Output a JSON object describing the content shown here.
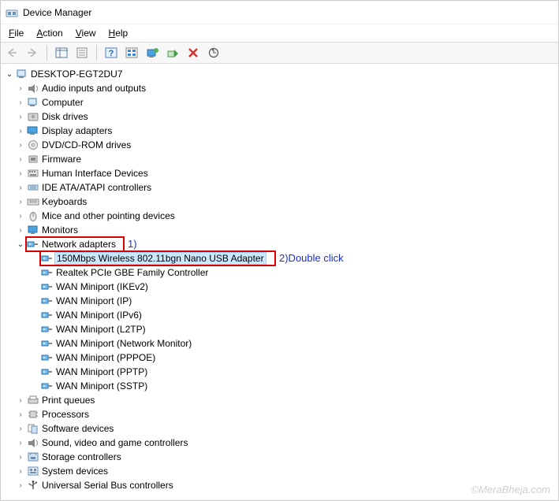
{
  "window": {
    "title": "Device Manager"
  },
  "menu": {
    "file": "File",
    "action": "Action",
    "view": "View",
    "help": "Help"
  },
  "root": {
    "name": "DESKTOP-EGT2DU7"
  },
  "categories": [
    {
      "label": "Audio inputs and outputs",
      "icon": "audio"
    },
    {
      "label": "Computer",
      "icon": "computer"
    },
    {
      "label": "Disk drives",
      "icon": "disk"
    },
    {
      "label": "Display adapters",
      "icon": "display"
    },
    {
      "label": "DVD/CD-ROM drives",
      "icon": "dvd"
    },
    {
      "label": "Firmware",
      "icon": "firmware"
    },
    {
      "label": "Human Interface Devices",
      "icon": "hid"
    },
    {
      "label": "IDE ATA/ATAPI controllers",
      "icon": "ide"
    },
    {
      "label": "Keyboards",
      "icon": "keyboard"
    },
    {
      "label": "Mice and other pointing devices",
      "icon": "mouse"
    },
    {
      "label": "Monitors",
      "icon": "monitor"
    }
  ],
  "network_adapters": {
    "label": "Network adapters",
    "children": [
      {
        "label": "150Mbps Wireless 802.11bgn Nano USB Adapter",
        "selected": true
      },
      {
        "label": "Realtek PCIe GBE Family Controller"
      },
      {
        "label": "WAN Miniport (IKEv2)"
      },
      {
        "label": "WAN Miniport (IP)"
      },
      {
        "label": "WAN Miniport (IPv6)"
      },
      {
        "label": "WAN Miniport (L2TP)"
      },
      {
        "label": "WAN Miniport (Network Monitor)"
      },
      {
        "label": "WAN Miniport (PPPOE)"
      },
      {
        "label": "WAN Miniport (PPTP)"
      },
      {
        "label": "WAN Miniport (SSTP)"
      }
    ]
  },
  "categories_after": [
    {
      "label": "Print queues",
      "icon": "printqueue"
    },
    {
      "label": "Processors",
      "icon": "cpu"
    },
    {
      "label": "Software devices",
      "icon": "software"
    },
    {
      "label": "Sound, video and game controllers",
      "icon": "sound"
    },
    {
      "label": "Storage controllers",
      "icon": "storage"
    },
    {
      "label": "System devices",
      "icon": "system"
    },
    {
      "label": "Universal Serial Bus controllers",
      "icon": "usb"
    }
  ],
  "annotations": {
    "one": "1)",
    "two": "2)Double click"
  },
  "watermark": "©MeraBheja.com"
}
